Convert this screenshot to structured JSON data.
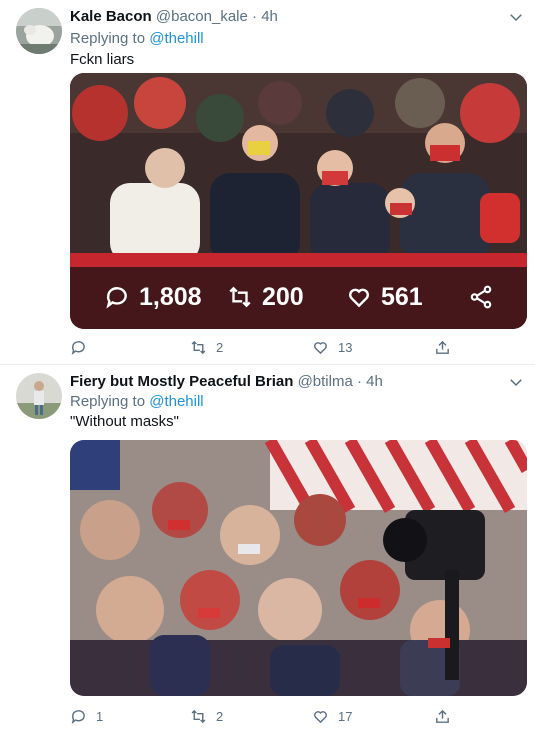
{
  "tweets": [
    {
      "name": "Kale Bacon",
      "handle": "@bacon_kale",
      "separator": "·",
      "time": "4h",
      "replying_prefix": "Replying to",
      "replying_to": "@thehill",
      "text": "Fckn liars",
      "media_overlay": {
        "replies": "1,808",
        "retweets": "200",
        "likes": "561"
      },
      "actions": {
        "replies": "",
        "retweets": "2",
        "likes": "13"
      }
    },
    {
      "name": "Fiery but Mostly Peaceful Brian",
      "handle": "@btilma",
      "separator": "·",
      "time": "4h",
      "replying_prefix": "Replying to",
      "replying_to": "@thehill",
      "text": "\"Without masks\"",
      "actions": {
        "replies": "1",
        "retweets": "2",
        "likes": "17"
      }
    }
  ],
  "colors": {
    "accent": "#1b95e0",
    "secondary_text": "#5b7083",
    "divider": "#e6ecf0"
  }
}
